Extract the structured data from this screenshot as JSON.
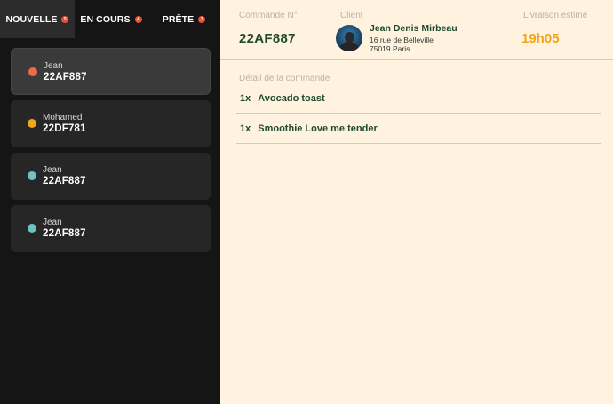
{
  "tabs": [
    {
      "label": "NOUVELLE",
      "badge": "5",
      "active": true
    },
    {
      "label": "EN COURS",
      "badge": "4",
      "active": false
    },
    {
      "label": "PRÊTE",
      "badge": "7",
      "active": false
    }
  ],
  "orders": [
    {
      "name": "Jean",
      "code": "22AF887",
      "dot_color": "#ee6a4c"
    },
    {
      "name": "Mohamed",
      "code": "22DF781",
      "dot_color": "#f2a516"
    },
    {
      "name": "Jean",
      "code": "22AF887",
      "dot_color": "#6cc5c2"
    },
    {
      "name": "Jean",
      "code": "22AF887",
      "dot_color": "#6cc5c2"
    }
  ],
  "header": {
    "commande_label": "Commande N°",
    "commande_value": "22AF887",
    "client_label": "Client",
    "client_name": "Jean Denis Mirbeau",
    "client_address_line1": "16 rue de Belleville",
    "client_address_line2": "75019 Paris",
    "livraison_label": "Livraison estimé",
    "livraison_value": "19h05"
  },
  "detail": {
    "label": "Détail de la commande",
    "items": [
      {
        "qty": "1x",
        "name": "Avocado toast"
      },
      {
        "qty": "1x",
        "name": "Smoothie Love me tender"
      }
    ]
  },
  "colors": {
    "sidebar_bg": "#151515",
    "main_bg": "#fff2de",
    "accent_green": "#1e4a2d",
    "accent_orange": "#f2a516",
    "badge_red": "#e8503a"
  }
}
